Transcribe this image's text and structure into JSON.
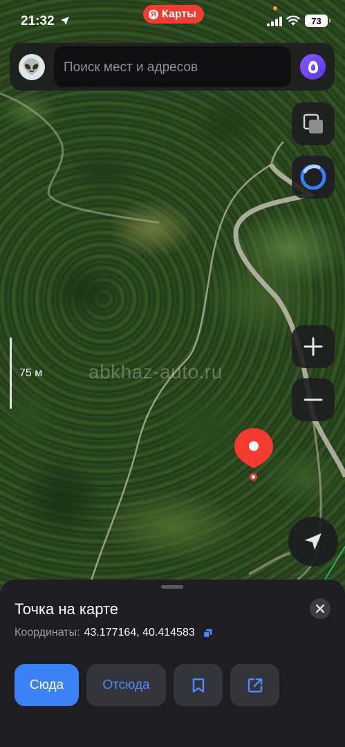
{
  "status_bar": {
    "time": "21:32",
    "battery": "73"
  },
  "app_pill": {
    "badge": "Я",
    "label": "Карты"
  },
  "search": {
    "placeholder": "Поиск мест и адресов",
    "avatar_emoji": "👽"
  },
  "map": {
    "scale_label": "75 м",
    "watermark": "abkhaz-auto.ru"
  },
  "sheet": {
    "title": "Точка на карте",
    "coords_label": "Координаты:",
    "coords_value": "43.177164, 40.414583",
    "buttons": {
      "here": "Сюда",
      "from": "Отсюда"
    }
  },
  "colors": {
    "accent_blue": "#3b82f6",
    "link_blue": "#4f8bff",
    "pin_red": "#f43b2f",
    "alice_purple": "#7a4cff"
  },
  "icons": [
    "location-arrow-icon",
    "signal-icon",
    "wifi-icon",
    "avatar-icon",
    "alice-icon",
    "layers-icon",
    "zoom-in-icon",
    "zoom-out-icon",
    "locate-icon",
    "close-icon",
    "copy-icon",
    "bookmark-icon",
    "share-icon"
  ]
}
